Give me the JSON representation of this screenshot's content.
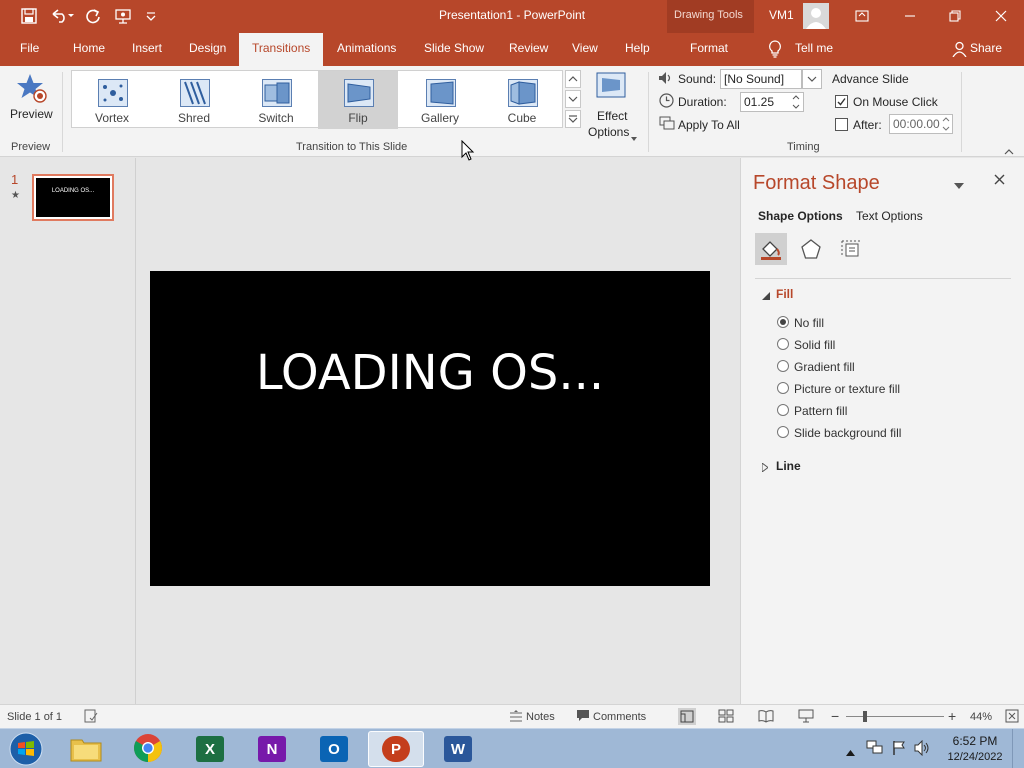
{
  "window": {
    "title": "Presentation1  -  PowerPoint",
    "context_tools": "Drawing Tools",
    "user": "VM1"
  },
  "tabs": [
    {
      "label": "File"
    },
    {
      "label": "Home"
    },
    {
      "label": "Insert"
    },
    {
      "label": "Design"
    },
    {
      "label": "Transitions"
    },
    {
      "label": "Animations"
    },
    {
      "label": "Slide Show"
    },
    {
      "label": "Review"
    },
    {
      "label": "View"
    },
    {
      "label": "Help"
    },
    {
      "label": "Format"
    }
  ],
  "active_tab": "Transitions",
  "tell_me": "Tell me",
  "share": "Share",
  "ribbon": {
    "preview_label": "Preview",
    "preview_group": "Preview",
    "transitions": [
      {
        "label": "Vortex"
      },
      {
        "label": "Shred"
      },
      {
        "label": "Switch"
      },
      {
        "label": "Flip",
        "selected": true
      },
      {
        "label": "Gallery"
      },
      {
        "label": "Cube"
      }
    ],
    "effect_options_1": "Effect",
    "effect_options_2": "Options",
    "transition_group": "Transition to This Slide",
    "sound_label": "Sound:",
    "sound_value": "[No Sound]",
    "duration_label": "Duration:",
    "duration_value": "01.25",
    "apply_all": "Apply To All",
    "advance_slide": "Advance Slide",
    "on_mouse_click": "On Mouse Click",
    "on_mouse_click_checked": true,
    "after_label": "After:",
    "after_checked": false,
    "after_value": "00:00.00",
    "timing_group": "Timing"
  },
  "thumbnails": [
    {
      "number": "1",
      "text": "LOADING OS..."
    }
  ],
  "slide": {
    "text": "LOADING OS..."
  },
  "format_pane": {
    "title": "Format Shape",
    "shape_options": "Shape Options",
    "text_options": "Text Options",
    "fill_section": "Fill",
    "fill_options": [
      {
        "label": "No fill",
        "checked": true
      },
      {
        "label": "Solid fill",
        "checked": false
      },
      {
        "label": "Gradient fill",
        "checked": false
      },
      {
        "label": "Picture or texture fill",
        "checked": false
      },
      {
        "label": "Pattern fill",
        "checked": false
      },
      {
        "label": "Slide background fill",
        "checked": false
      }
    ],
    "line_section": "Line"
  },
  "status": {
    "slide_info": "Slide 1 of 1",
    "notes": "Notes",
    "comments": "Comments",
    "zoom": "44%",
    "zoom_fraction": 0.44
  },
  "taskbar": {
    "apps": [
      {
        "name": "Windows Explorer"
      },
      {
        "name": "Google Chrome"
      },
      {
        "name": "Excel"
      },
      {
        "name": "OneNote"
      },
      {
        "name": "Outlook"
      },
      {
        "name": "PowerPoint",
        "active": true
      },
      {
        "name": "Word"
      }
    ],
    "time": "6:52 PM",
    "date": "12/24/2022"
  },
  "colors": {
    "accent": "#b7472a",
    "accent_dark": "#a13c23",
    "slide_bg": "#000000"
  }
}
